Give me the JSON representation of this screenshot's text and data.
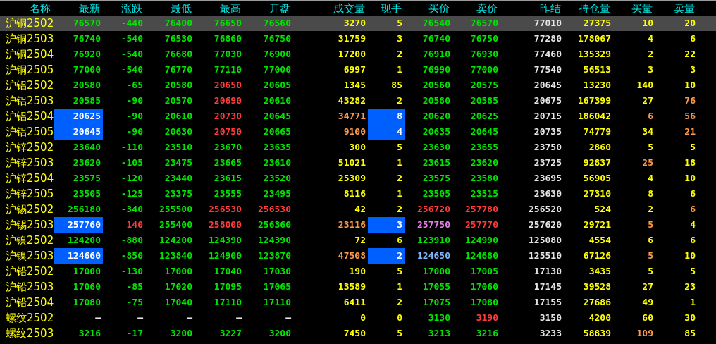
{
  "columns": [
    {
      "label": "名称"
    },
    {
      "label": "最新"
    },
    {
      "label": "涨跌"
    },
    {
      "label": "最低"
    },
    {
      "label": "最高"
    },
    {
      "label": "开盘"
    },
    {
      "label": "成交量"
    },
    {
      "label": "现手"
    },
    {
      "label": "买价"
    },
    {
      "label": "卖价"
    },
    {
      "label": "昨结"
    },
    {
      "label": "持仓量"
    },
    {
      "label": "买量"
    },
    {
      "label": "卖量"
    }
  ],
  "rows": [
    {
      "name": "沪铜2502",
      "selected": true,
      "cells": [
        {
          "text": "76570",
          "color": "#00e600",
          "highlighted": false
        },
        {
          "text": "-440",
          "color": "#00e600",
          "highlighted": false
        },
        {
          "text": "76400",
          "color": "#00e600",
          "highlighted": false
        },
        {
          "text": "76650",
          "color": "#00e600",
          "highlighted": false
        },
        {
          "text": "76560",
          "color": "#00e600",
          "highlighted": false
        },
        {
          "text": "3270",
          "color": "#ffff00",
          "highlighted": false
        },
        {
          "text": "5",
          "color": "#ffff00",
          "highlighted": false
        },
        {
          "text": "76540",
          "color": "#00e600",
          "highlighted": false
        },
        {
          "text": "76570",
          "color": "#00e600",
          "highlighted": false
        },
        {
          "text": "77010",
          "color": "#e6e6e6",
          "highlighted": false
        },
        {
          "text": "27375",
          "color": "#ffff00",
          "highlighted": false
        },
        {
          "text": "10",
          "color": "#ffff00",
          "highlighted": false
        },
        {
          "text": "20",
          "color": "#ffff00",
          "highlighted": false
        }
      ]
    },
    {
      "name": "沪铜2503",
      "selected": false,
      "cells": [
        {
          "text": "76740",
          "color": "#00e600",
          "highlighted": false
        },
        {
          "text": "-540",
          "color": "#00e600",
          "highlighted": false
        },
        {
          "text": "76530",
          "color": "#00e600",
          "highlighted": false
        },
        {
          "text": "76860",
          "color": "#00e600",
          "highlighted": false
        },
        {
          "text": "76750",
          "color": "#00e600",
          "highlighted": false
        },
        {
          "text": "31759",
          "color": "#ffff00",
          "highlighted": false
        },
        {
          "text": "3",
          "color": "#ffff00",
          "highlighted": false
        },
        {
          "text": "76740",
          "color": "#00e600",
          "highlighted": false
        },
        {
          "text": "76750",
          "color": "#00e600",
          "highlighted": false
        },
        {
          "text": "77280",
          "color": "#e6e6e6",
          "highlighted": false
        },
        {
          "text": "178067",
          "color": "#ffff00",
          "highlighted": false
        },
        {
          "text": "4",
          "color": "#ffff00",
          "highlighted": false
        },
        {
          "text": "6",
          "color": "#ffff00",
          "highlighted": false
        }
      ]
    },
    {
      "name": "沪铜2504",
      "selected": false,
      "cells": [
        {
          "text": "76920",
          "color": "#00e600",
          "highlighted": false
        },
        {
          "text": "-540",
          "color": "#00e600",
          "highlighted": false
        },
        {
          "text": "76680",
          "color": "#00e600",
          "highlighted": false
        },
        {
          "text": "77030",
          "color": "#00e600",
          "highlighted": false
        },
        {
          "text": "76900",
          "color": "#00e600",
          "highlighted": false
        },
        {
          "text": "17200",
          "color": "#ffff00",
          "highlighted": false
        },
        {
          "text": "2",
          "color": "#ffff00",
          "highlighted": false
        },
        {
          "text": "76910",
          "color": "#00e600",
          "highlighted": false
        },
        {
          "text": "76930",
          "color": "#00e600",
          "highlighted": false
        },
        {
          "text": "77460",
          "color": "#e6e6e6",
          "highlighted": false
        },
        {
          "text": "135329",
          "color": "#ffff00",
          "highlighted": false
        },
        {
          "text": "2",
          "color": "#ffff00",
          "highlighted": false
        },
        {
          "text": "22",
          "color": "#ffff00",
          "highlighted": false
        }
      ]
    },
    {
      "name": "沪铜2505",
      "selected": false,
      "cells": [
        {
          "text": "77000",
          "color": "#00e600",
          "highlighted": false
        },
        {
          "text": "-540",
          "color": "#00e600",
          "highlighted": false
        },
        {
          "text": "76770",
          "color": "#00e600",
          "highlighted": false
        },
        {
          "text": "77110",
          "color": "#00e600",
          "highlighted": false
        },
        {
          "text": "77000",
          "color": "#00e600",
          "highlighted": false
        },
        {
          "text": "6997",
          "color": "#ffff00",
          "highlighted": false
        },
        {
          "text": "1",
          "color": "#ffff00",
          "highlighted": false
        },
        {
          "text": "76990",
          "color": "#00e600",
          "highlighted": false
        },
        {
          "text": "77000",
          "color": "#00e600",
          "highlighted": false
        },
        {
          "text": "77540",
          "color": "#e6e6e6",
          "highlighted": false
        },
        {
          "text": "56513",
          "color": "#ffff00",
          "highlighted": false
        },
        {
          "text": "3",
          "color": "#ffff00",
          "highlighted": false
        },
        {
          "text": "3",
          "color": "#ffff00",
          "highlighted": false
        }
      ]
    },
    {
      "name": "沪铝2502",
      "selected": false,
      "cells": [
        {
          "text": "20580",
          "color": "#00e600",
          "highlighted": false
        },
        {
          "text": "-65",
          "color": "#00e600",
          "highlighted": false
        },
        {
          "text": "20580",
          "color": "#00e600",
          "highlighted": false
        },
        {
          "text": "20650",
          "color": "#ff3c3c",
          "highlighted": false
        },
        {
          "text": "20605",
          "color": "#00e600",
          "highlighted": false
        },
        {
          "text": "1345",
          "color": "#ffff00",
          "highlighted": false
        },
        {
          "text": "85",
          "color": "#ffff00",
          "highlighted": false
        },
        {
          "text": "20560",
          "color": "#00e600",
          "highlighted": false
        },
        {
          "text": "20575",
          "color": "#00e600",
          "highlighted": false
        },
        {
          "text": "20645",
          "color": "#e6e6e6",
          "highlighted": false
        },
        {
          "text": "13230",
          "color": "#ffff00",
          "highlighted": false
        },
        {
          "text": "140",
          "color": "#ffff00",
          "highlighted": false
        },
        {
          "text": "10",
          "color": "#ffff00",
          "highlighted": false
        }
      ]
    },
    {
      "name": "沪铝2503",
      "selected": false,
      "cells": [
        {
          "text": "20585",
          "color": "#00e600",
          "highlighted": false
        },
        {
          "text": "-90",
          "color": "#00e600",
          "highlighted": false
        },
        {
          "text": "20570",
          "color": "#00e600",
          "highlighted": false
        },
        {
          "text": "20690",
          "color": "#ff3c3c",
          "highlighted": false
        },
        {
          "text": "20610",
          "color": "#00e600",
          "highlighted": false
        },
        {
          "text": "43282",
          "color": "#ffff00",
          "highlighted": false
        },
        {
          "text": "2",
          "color": "#ffff00",
          "highlighted": false
        },
        {
          "text": "20580",
          "color": "#00e600",
          "highlighted": false
        },
        {
          "text": "20585",
          "color": "#00e600",
          "highlighted": false
        },
        {
          "text": "20675",
          "color": "#e6e6e6",
          "highlighted": false
        },
        {
          "text": "167399",
          "color": "#ffff00",
          "highlighted": false
        },
        {
          "text": "27",
          "color": "#ffff00",
          "highlighted": false
        },
        {
          "text": "76",
          "color": "#ff9a4a",
          "highlighted": false
        }
      ]
    },
    {
      "name": "沪铝2504",
      "selected": false,
      "cells": [
        {
          "text": "20625",
          "color": "#ffffff",
          "highlighted": true
        },
        {
          "text": "-90",
          "color": "#00e600",
          "highlighted": false
        },
        {
          "text": "20610",
          "color": "#00e600",
          "highlighted": false
        },
        {
          "text": "20730",
          "color": "#ff3c3c",
          "highlighted": false
        },
        {
          "text": "20645",
          "color": "#00e600",
          "highlighted": false
        },
        {
          "text": "34771",
          "color": "#ff9a4a",
          "highlighted": false
        },
        {
          "text": "8",
          "color": "#ffffff",
          "highlighted": true
        },
        {
          "text": "20620",
          "color": "#00e600",
          "highlighted": false
        },
        {
          "text": "20625",
          "color": "#00e600",
          "highlighted": false
        },
        {
          "text": "20715",
          "color": "#e6e6e6",
          "highlighted": false
        },
        {
          "text": "186042",
          "color": "#ffff00",
          "highlighted": false
        },
        {
          "text": "6",
          "color": "#ff9a4a",
          "highlighted": false
        },
        {
          "text": "56",
          "color": "#ff9a4a",
          "highlighted": false
        }
      ]
    },
    {
      "name": "沪铝2505",
      "selected": false,
      "cells": [
        {
          "text": "20645",
          "color": "#ffffff",
          "highlighted": true
        },
        {
          "text": "-90",
          "color": "#00e600",
          "highlighted": false
        },
        {
          "text": "20630",
          "color": "#00e600",
          "highlighted": false
        },
        {
          "text": "20750",
          "color": "#ff3c3c",
          "highlighted": false
        },
        {
          "text": "20665",
          "color": "#00e600",
          "highlighted": false
        },
        {
          "text": "9100",
          "color": "#ff9a4a",
          "highlighted": false
        },
        {
          "text": "4",
          "color": "#ffffff",
          "highlighted": true
        },
        {
          "text": "20635",
          "color": "#00e600",
          "highlighted": false
        },
        {
          "text": "20645",
          "color": "#00e600",
          "highlighted": false
        },
        {
          "text": "20735",
          "color": "#e6e6e6",
          "highlighted": false
        },
        {
          "text": "74779",
          "color": "#ffff00",
          "highlighted": false
        },
        {
          "text": "34",
          "color": "#ffff00",
          "highlighted": false
        },
        {
          "text": "21",
          "color": "#ff9a4a",
          "highlighted": false
        }
      ]
    },
    {
      "name": "沪锌2502",
      "selected": false,
      "cells": [
        {
          "text": "23640",
          "color": "#00e600",
          "highlighted": false
        },
        {
          "text": "-110",
          "color": "#00e600",
          "highlighted": false
        },
        {
          "text": "23510",
          "color": "#00e600",
          "highlighted": false
        },
        {
          "text": "23670",
          "color": "#00e600",
          "highlighted": false
        },
        {
          "text": "23635",
          "color": "#00e600",
          "highlighted": false
        },
        {
          "text": "300",
          "color": "#ffff00",
          "highlighted": false
        },
        {
          "text": "5",
          "color": "#ffff00",
          "highlighted": false
        },
        {
          "text": "23630",
          "color": "#00e600",
          "highlighted": false
        },
        {
          "text": "23655",
          "color": "#00e600",
          "highlighted": false
        },
        {
          "text": "23750",
          "color": "#e6e6e6",
          "highlighted": false
        },
        {
          "text": "2860",
          "color": "#ffff00",
          "highlighted": false
        },
        {
          "text": "5",
          "color": "#ffff00",
          "highlighted": false
        },
        {
          "text": "5",
          "color": "#ffff00",
          "highlighted": false
        }
      ]
    },
    {
      "name": "沪锌2503",
      "selected": false,
      "cells": [
        {
          "text": "23620",
          "color": "#00e600",
          "highlighted": false
        },
        {
          "text": "-105",
          "color": "#00e600",
          "highlighted": false
        },
        {
          "text": "23475",
          "color": "#00e600",
          "highlighted": false
        },
        {
          "text": "23665",
          "color": "#00e600",
          "highlighted": false
        },
        {
          "text": "23610",
          "color": "#00e600",
          "highlighted": false
        },
        {
          "text": "51021",
          "color": "#ffff00",
          "highlighted": false
        },
        {
          "text": "1",
          "color": "#ffff00",
          "highlighted": false
        },
        {
          "text": "23615",
          "color": "#00e600",
          "highlighted": false
        },
        {
          "text": "23620",
          "color": "#00e600",
          "highlighted": false
        },
        {
          "text": "23725",
          "color": "#e6e6e6",
          "highlighted": false
        },
        {
          "text": "92837",
          "color": "#ffff00",
          "highlighted": false
        },
        {
          "text": "25",
          "color": "#ff9a4a",
          "highlighted": false
        },
        {
          "text": "18",
          "color": "#ffff00",
          "highlighted": false
        }
      ]
    },
    {
      "name": "沪锌2504",
      "selected": false,
      "cells": [
        {
          "text": "23575",
          "color": "#00e600",
          "highlighted": false
        },
        {
          "text": "-120",
          "color": "#00e600",
          "highlighted": false
        },
        {
          "text": "23440",
          "color": "#00e600",
          "highlighted": false
        },
        {
          "text": "23615",
          "color": "#00e600",
          "highlighted": false
        },
        {
          "text": "23520",
          "color": "#00e600",
          "highlighted": false
        },
        {
          "text": "25309",
          "color": "#ffff00",
          "highlighted": false
        },
        {
          "text": "2",
          "color": "#ffff00",
          "highlighted": false
        },
        {
          "text": "23575",
          "color": "#00e600",
          "highlighted": false
        },
        {
          "text": "23580",
          "color": "#00e600",
          "highlighted": false
        },
        {
          "text": "23695",
          "color": "#e6e6e6",
          "highlighted": false
        },
        {
          "text": "56905",
          "color": "#ffff00",
          "highlighted": false
        },
        {
          "text": "4",
          "color": "#ffff00",
          "highlighted": false
        },
        {
          "text": "10",
          "color": "#ffff00",
          "highlighted": false
        }
      ]
    },
    {
      "name": "沪锌2505",
      "selected": false,
      "cells": [
        {
          "text": "23505",
          "color": "#00e600",
          "highlighted": false
        },
        {
          "text": "-125",
          "color": "#00e600",
          "highlighted": false
        },
        {
          "text": "23375",
          "color": "#00e600",
          "highlighted": false
        },
        {
          "text": "23555",
          "color": "#00e600",
          "highlighted": false
        },
        {
          "text": "23495",
          "color": "#00e600",
          "highlighted": false
        },
        {
          "text": "8116",
          "color": "#ffff00",
          "highlighted": false
        },
        {
          "text": "1",
          "color": "#ffff00",
          "highlighted": false
        },
        {
          "text": "23505",
          "color": "#00e600",
          "highlighted": false
        },
        {
          "text": "23515",
          "color": "#00e600",
          "highlighted": false
        },
        {
          "text": "23630",
          "color": "#e6e6e6",
          "highlighted": false
        },
        {
          "text": "27310",
          "color": "#ffff00",
          "highlighted": false
        },
        {
          "text": "8",
          "color": "#ffff00",
          "highlighted": false
        },
        {
          "text": "6",
          "color": "#ffff00",
          "highlighted": false
        }
      ]
    },
    {
      "name": "沪锡2502",
      "selected": false,
      "cells": [
        {
          "text": "256180",
          "color": "#00e600",
          "highlighted": false
        },
        {
          "text": "-340",
          "color": "#00e600",
          "highlighted": false
        },
        {
          "text": "255500",
          "color": "#00e600",
          "highlighted": false
        },
        {
          "text": "256530",
          "color": "#ff3c3c",
          "highlighted": false
        },
        {
          "text": "256530",
          "color": "#ff3c3c",
          "highlighted": false
        },
        {
          "text": "42",
          "color": "#ffff00",
          "highlighted": false
        },
        {
          "text": "2",
          "color": "#ffff00",
          "highlighted": false
        },
        {
          "text": "256720",
          "color": "#ff3c3c",
          "highlighted": false
        },
        {
          "text": "257780",
          "color": "#ff3c3c",
          "highlighted": false
        },
        {
          "text": "256520",
          "color": "#e6e6e6",
          "highlighted": false
        },
        {
          "text": "524",
          "color": "#ffff00",
          "highlighted": false
        },
        {
          "text": "2",
          "color": "#ffff00",
          "highlighted": false
        },
        {
          "text": "6",
          "color": "#ff9a4a",
          "highlighted": false
        }
      ]
    },
    {
      "name": "沪锡2503",
      "selected": false,
      "cells": [
        {
          "text": "257760",
          "color": "#ffffff",
          "highlighted": true
        },
        {
          "text": "140",
          "color": "#ff3c3c",
          "highlighted": false
        },
        {
          "text": "255400",
          "color": "#00e600",
          "highlighted": false
        },
        {
          "text": "258000",
          "color": "#ff3c3c",
          "highlighted": false
        },
        {
          "text": "256360",
          "color": "#00e600",
          "highlighted": false
        },
        {
          "text": "23116",
          "color": "#ff9a4a",
          "highlighted": false
        },
        {
          "text": "3",
          "color": "#ffffff",
          "highlighted": true
        },
        {
          "text": "257750",
          "color": "#e682e6",
          "highlighted": false
        },
        {
          "text": "257770",
          "color": "#ff3c3c",
          "highlighted": false
        },
        {
          "text": "257620",
          "color": "#e6e6e6",
          "highlighted": false
        },
        {
          "text": "29721",
          "color": "#ffff00",
          "highlighted": false
        },
        {
          "text": "5",
          "color": "#ff9a4a",
          "highlighted": false
        },
        {
          "text": "4",
          "color": "#ffff00",
          "highlighted": false
        }
      ]
    },
    {
      "name": "沪镍2502",
      "selected": false,
      "cells": [
        {
          "text": "124200",
          "color": "#00e600",
          "highlighted": false
        },
        {
          "text": "-880",
          "color": "#00e600",
          "highlighted": false
        },
        {
          "text": "124200",
          "color": "#00e600",
          "highlighted": false
        },
        {
          "text": "124390",
          "color": "#00e600",
          "highlighted": false
        },
        {
          "text": "124390",
          "color": "#00e600",
          "highlighted": false
        },
        {
          "text": "72",
          "color": "#ffff00",
          "highlighted": false
        },
        {
          "text": "6",
          "color": "#ffff00",
          "highlighted": false
        },
        {
          "text": "123910",
          "color": "#00e600",
          "highlighted": false
        },
        {
          "text": "124990",
          "color": "#00e600",
          "highlighted": false
        },
        {
          "text": "125080",
          "color": "#e6e6e6",
          "highlighted": false
        },
        {
          "text": "4554",
          "color": "#ffff00",
          "highlighted": false
        },
        {
          "text": "6",
          "color": "#ffff00",
          "highlighted": false
        },
        {
          "text": "6",
          "color": "#ffff00",
          "highlighted": false
        }
      ]
    },
    {
      "name": "沪镍2503",
      "selected": false,
      "cells": [
        {
          "text": "124660",
          "color": "#ffffff",
          "highlighted": true
        },
        {
          "text": "-850",
          "color": "#00e600",
          "highlighted": false
        },
        {
          "text": "123840",
          "color": "#00e600",
          "highlighted": false
        },
        {
          "text": "124900",
          "color": "#00e600",
          "highlighted": false
        },
        {
          "text": "123870",
          "color": "#00e600",
          "highlighted": false
        },
        {
          "text": "47508",
          "color": "#ff9a4a",
          "highlighted": false
        },
        {
          "text": "2",
          "color": "#ffffff",
          "highlighted": true
        },
        {
          "text": "124650",
          "color": "#80b8ff",
          "highlighted": false
        },
        {
          "text": "124680",
          "color": "#00e600",
          "highlighted": false
        },
        {
          "text": "125510",
          "color": "#e6e6e6",
          "highlighted": false
        },
        {
          "text": "67126",
          "color": "#ffff00",
          "highlighted": false
        },
        {
          "text": "5",
          "color": "#ff9a4a",
          "highlighted": false
        },
        {
          "text": "10",
          "color": "#ffff00",
          "highlighted": false
        }
      ]
    },
    {
      "name": "沪铅2502",
      "selected": false,
      "cells": [
        {
          "text": "17000",
          "color": "#00e600",
          "highlighted": false
        },
        {
          "text": "-130",
          "color": "#00e600",
          "highlighted": false
        },
        {
          "text": "17000",
          "color": "#00e600",
          "highlighted": false
        },
        {
          "text": "17040",
          "color": "#00e600",
          "highlighted": false
        },
        {
          "text": "17030",
          "color": "#00e600",
          "highlighted": false
        },
        {
          "text": "190",
          "color": "#ffff00",
          "highlighted": false
        },
        {
          "text": "5",
          "color": "#ffff00",
          "highlighted": false
        },
        {
          "text": "17000",
          "color": "#00e600",
          "highlighted": false
        },
        {
          "text": "17005",
          "color": "#00e600",
          "highlighted": false
        },
        {
          "text": "17130",
          "color": "#e6e6e6",
          "highlighted": false
        },
        {
          "text": "3435",
          "color": "#ffff00",
          "highlighted": false
        },
        {
          "text": "5",
          "color": "#ffff00",
          "highlighted": false
        },
        {
          "text": "5",
          "color": "#ffff00",
          "highlighted": false
        }
      ]
    },
    {
      "name": "沪铅2503",
      "selected": false,
      "cells": [
        {
          "text": "17060",
          "color": "#00e600",
          "highlighted": false
        },
        {
          "text": "-85",
          "color": "#00e600",
          "highlighted": false
        },
        {
          "text": "17020",
          "color": "#00e600",
          "highlighted": false
        },
        {
          "text": "17095",
          "color": "#00e600",
          "highlighted": false
        },
        {
          "text": "17065",
          "color": "#00e600",
          "highlighted": false
        },
        {
          "text": "13589",
          "color": "#ffff00",
          "highlighted": false
        },
        {
          "text": "1",
          "color": "#ffff00",
          "highlighted": false
        },
        {
          "text": "17055",
          "color": "#00e600",
          "highlighted": false
        },
        {
          "text": "17060",
          "color": "#00e600",
          "highlighted": false
        },
        {
          "text": "17145",
          "color": "#e6e6e6",
          "highlighted": false
        },
        {
          "text": "39528",
          "color": "#ffff00",
          "highlighted": false
        },
        {
          "text": "27",
          "color": "#ffff00",
          "highlighted": false
        },
        {
          "text": "23",
          "color": "#ffff00",
          "highlighted": false
        }
      ]
    },
    {
      "name": "沪铅2504",
      "selected": false,
      "cells": [
        {
          "text": "17080",
          "color": "#00e600",
          "highlighted": false
        },
        {
          "text": "-75",
          "color": "#00e600",
          "highlighted": false
        },
        {
          "text": "17040",
          "color": "#00e600",
          "highlighted": false
        },
        {
          "text": "17110",
          "color": "#00e600",
          "highlighted": false
        },
        {
          "text": "17110",
          "color": "#00e600",
          "highlighted": false
        },
        {
          "text": "6411",
          "color": "#ffff00",
          "highlighted": false
        },
        {
          "text": "2",
          "color": "#ffff00",
          "highlighted": false
        },
        {
          "text": "17075",
          "color": "#00e600",
          "highlighted": false
        },
        {
          "text": "17080",
          "color": "#00e600",
          "highlighted": false
        },
        {
          "text": "17155",
          "color": "#e6e6e6",
          "highlighted": false
        },
        {
          "text": "27686",
          "color": "#ffff00",
          "highlighted": false
        },
        {
          "text": "49",
          "color": "#ffff00",
          "highlighted": false
        },
        {
          "text": "1",
          "color": "#ffff00",
          "highlighted": false
        }
      ]
    },
    {
      "name": "螺纹2502",
      "selected": false,
      "cells": [
        {
          "text": "—",
          "color": "#e6e6e6",
          "highlighted": false
        },
        {
          "text": "—",
          "color": "#e6e6e6",
          "highlighted": false
        },
        {
          "text": "—",
          "color": "#e6e6e6",
          "highlighted": false
        },
        {
          "text": "—",
          "color": "#e6e6e6",
          "highlighted": false
        },
        {
          "text": "—",
          "color": "#e6e6e6",
          "highlighted": false
        },
        {
          "text": "0",
          "color": "#ffff00",
          "highlighted": false
        },
        {
          "text": "0",
          "color": "#ffff00",
          "highlighted": false
        },
        {
          "text": "3130",
          "color": "#00e600",
          "highlighted": false
        },
        {
          "text": "3190",
          "color": "#ff3c3c",
          "highlighted": false
        },
        {
          "text": "3150",
          "color": "#e6e6e6",
          "highlighted": false
        },
        {
          "text": "4200",
          "color": "#ffff00",
          "highlighted": false
        },
        {
          "text": "60",
          "color": "#ffff00",
          "highlighted": false
        },
        {
          "text": "30",
          "color": "#ffff00",
          "highlighted": false
        }
      ]
    },
    {
      "name": "螺纹2503",
      "selected": false,
      "cells": [
        {
          "text": "3216",
          "color": "#00e600",
          "highlighted": false
        },
        {
          "text": "-17",
          "color": "#00e600",
          "highlighted": false
        },
        {
          "text": "3200",
          "color": "#00e600",
          "highlighted": false
        },
        {
          "text": "3227",
          "color": "#00e600",
          "highlighted": false
        },
        {
          "text": "3200",
          "color": "#00e600",
          "highlighted": false
        },
        {
          "text": "7450",
          "color": "#ffff00",
          "highlighted": false
        },
        {
          "text": "5",
          "color": "#ffff00",
          "highlighted": false
        },
        {
          "text": "3213",
          "color": "#00e600",
          "highlighted": false
        },
        {
          "text": "3216",
          "color": "#00e600",
          "highlighted": false
        },
        {
          "text": "3233",
          "color": "#e6e6e6",
          "highlighted": false
        },
        {
          "text": "58839",
          "color": "#ffff00",
          "highlighted": false
        },
        {
          "text": "109",
          "color": "#ff9a4a",
          "highlighted": false
        },
        {
          "text": "85",
          "color": "#ffff00",
          "highlighted": false
        }
      ]
    }
  ]
}
